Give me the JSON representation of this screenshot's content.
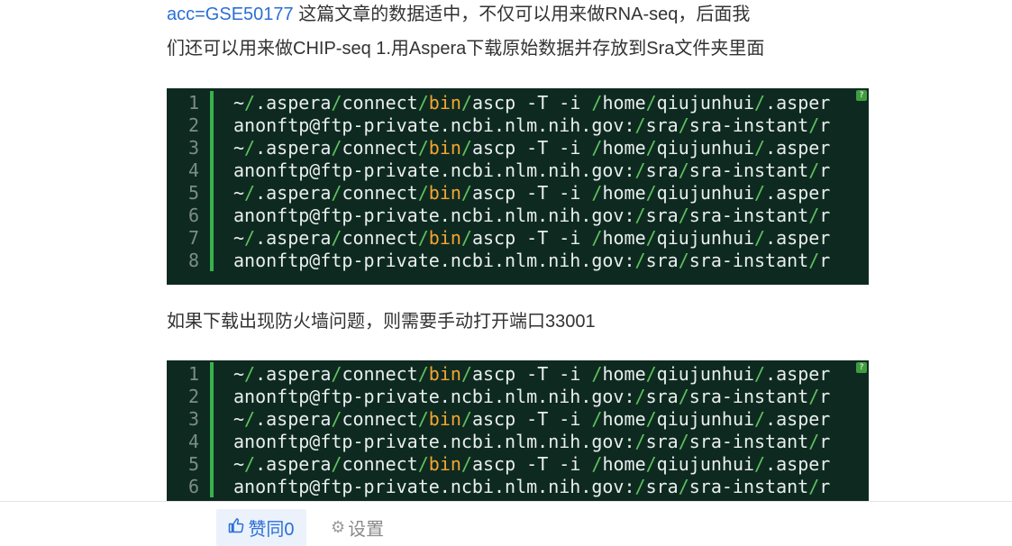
{
  "intro": {
    "link_text": "acc=GSE50177",
    "line1_rest": " 这篇文章的数据适中，不仅可以用来做RNA-seq，后面我",
    "line2": "们还可以用来做CHIP-seq 1.用Aspera下载原始数据并存放到Sra文件夹里面"
  },
  "code_block_1": {
    "line_numbers": [
      "1",
      "2",
      "3",
      "4",
      "5",
      "6",
      "7",
      "8"
    ],
    "corner_icon": "?"
  },
  "between_text": "如果下载出现防火墙问题，则需要手动打开端口33001",
  "code_block_2": {
    "line_numbers": [
      "1",
      "2",
      "3",
      "4",
      "5",
      "6"
    ],
    "corner_icon": "?"
  },
  "code_fragments": {
    "ascp_cmd": {
      "tilde": "~",
      "slash": "/",
      "aspera": ".aspera",
      "connect": "connect",
      "bin": "bin",
      "ascp_args": "ascp -T -i ",
      "home": "home",
      "user": "qiujunhui",
      "aspera_cut": ".asper"
    },
    "anon_line": {
      "host": "anonftp@ftp-private.ncbi.nlm.nih.gov:",
      "slash": "/",
      "sra": "sra",
      "instant": "sra-instant",
      "tail": "r"
    }
  },
  "colors": {
    "code_bg": "#0e2a20",
    "keyword": "#f7a531",
    "separator": "#5fc25f",
    "gutter_bar": "#37b24d",
    "link": "#2b6fd6"
  },
  "bottom_bar": {
    "like_icon": "thumbs-up-icon",
    "like_label": "赞同0",
    "settings_icon": "gear-icon",
    "settings_label": "设置"
  }
}
